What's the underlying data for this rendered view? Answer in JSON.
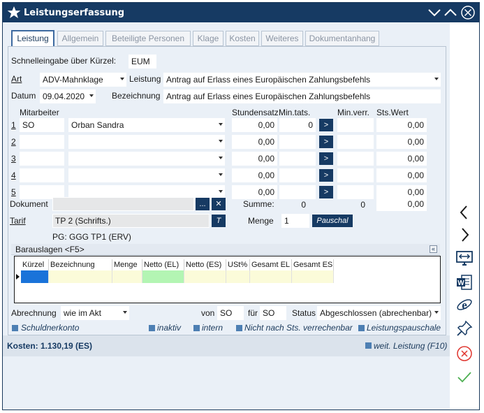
{
  "window": {
    "title": "Leistungserfassung"
  },
  "tabs": [
    "Leistung",
    "Allgemein",
    "Beteiligte Personen",
    "Klage",
    "Kosten",
    "Weiteres",
    "Dokumentanhang"
  ],
  "form": {
    "schnelleingabe_label": "Schnelleingabe über Kürzel:",
    "schnelleingabe_value": "EUM",
    "art_label": "Art",
    "art_value": "ADV-Mahnklage",
    "leistung_label": "Leistung",
    "leistung_value": "Antrag auf Erlass eines Europäischen Zahlungsbefehls",
    "datum_label": "Datum",
    "datum_value": "09.04.2020",
    "bezeichnung_label": "Bezeichnung",
    "bezeichnung_value": "Antrag auf Erlass eines Europäischen Zahlungsbefehls"
  },
  "mitarbeiter": {
    "header": "Mitarbeiter",
    "col_stundensatz": "Stundensatz",
    "col_mintats": "Min.tats.",
    "col_minverr": "Min.verr.",
    "col_stswert": "Sts.Wert",
    "rows": [
      {
        "num": "1",
        "code": "SO",
        "name": "Orban Sandra",
        "stundensatz": "0,00",
        "mintats": "0",
        "arrow": ">",
        "minverr": "",
        "stswert": "0,00"
      },
      {
        "num": "2",
        "code": "",
        "name": "",
        "stundensatz": "0,00",
        "mintats": "",
        "arrow": ">",
        "minverr": "",
        "stswert": "0,00"
      },
      {
        "num": "3",
        "code": "",
        "name": "",
        "stundensatz": "0,00",
        "mintats": "",
        "arrow": ">",
        "minverr": "",
        "stswert": "0,00"
      },
      {
        "num": "4",
        "code": "",
        "name": "",
        "stundensatz": "0,00",
        "mintats": "",
        "arrow": ">",
        "minverr": "",
        "stswert": "0,00"
      },
      {
        "num": "5",
        "code": "",
        "name": "",
        "stundensatz": "0,00",
        "mintats": "",
        "arrow": ">",
        "minverr": "",
        "stswert": "0,00"
      }
    ]
  },
  "dokument": {
    "label": "Dokument",
    "browse": "...",
    "clear": "✕"
  },
  "summe": {
    "label": "Summe:",
    "mintats": "0",
    "minverr": "0",
    "stswert": "0,00"
  },
  "tarif": {
    "label": "Tarif",
    "value": "TP 2 (Schrifts.)",
    "button": "T",
    "pg": "PG: GGG TP1 (ERV)"
  },
  "menge": {
    "label": "Menge",
    "value": "1",
    "pauschal": "Pauschal"
  },
  "barauslagen": {
    "title": "Barauslagen <F5>",
    "collapse": "«",
    "columns": [
      "Kürzel",
      "Bezeichnung",
      "Menge",
      "Netto (EL)",
      "Netto (ES)",
      "USt%",
      "Gesamt EL",
      "Gesamt ES"
    ]
  },
  "footer": {
    "abrechnung_label": "Abrechnung",
    "abrechnung_value": "wie im Akt",
    "von_label": "von",
    "von_value": "SO",
    "fuer_label": "für",
    "fuer_value": "SO",
    "status_label": "Status",
    "status_value": "Abgeschlossen (abrechenbar)",
    "schuldnerkonto": "Schuldnerkonto",
    "inaktiv": "inaktiv",
    "intern": "intern",
    "nicht_nach_sts": "Nicht nach Sts. verrechenbar",
    "leistungspauschale": "Leistungspauschale"
  },
  "status_bar": {
    "kosten": "Kosten: 1.130,19 (ES)",
    "weit_leistung": "weit. Leistung (F10)"
  },
  "sidebar_icons": [
    "chevron-left-icon",
    "chevron-right-icon",
    "screen-swap-icon",
    "word-icon",
    "internet-explorer-icon",
    "pin-icon",
    "cancel-icon",
    "confirm-icon"
  ],
  "colors": {
    "titlebar": "#163a63",
    "accent": "#3d6aa0",
    "dark_button": "#163a63",
    "netto_el": "#b3f5b3",
    "grid_row": "#fbfbd9"
  }
}
